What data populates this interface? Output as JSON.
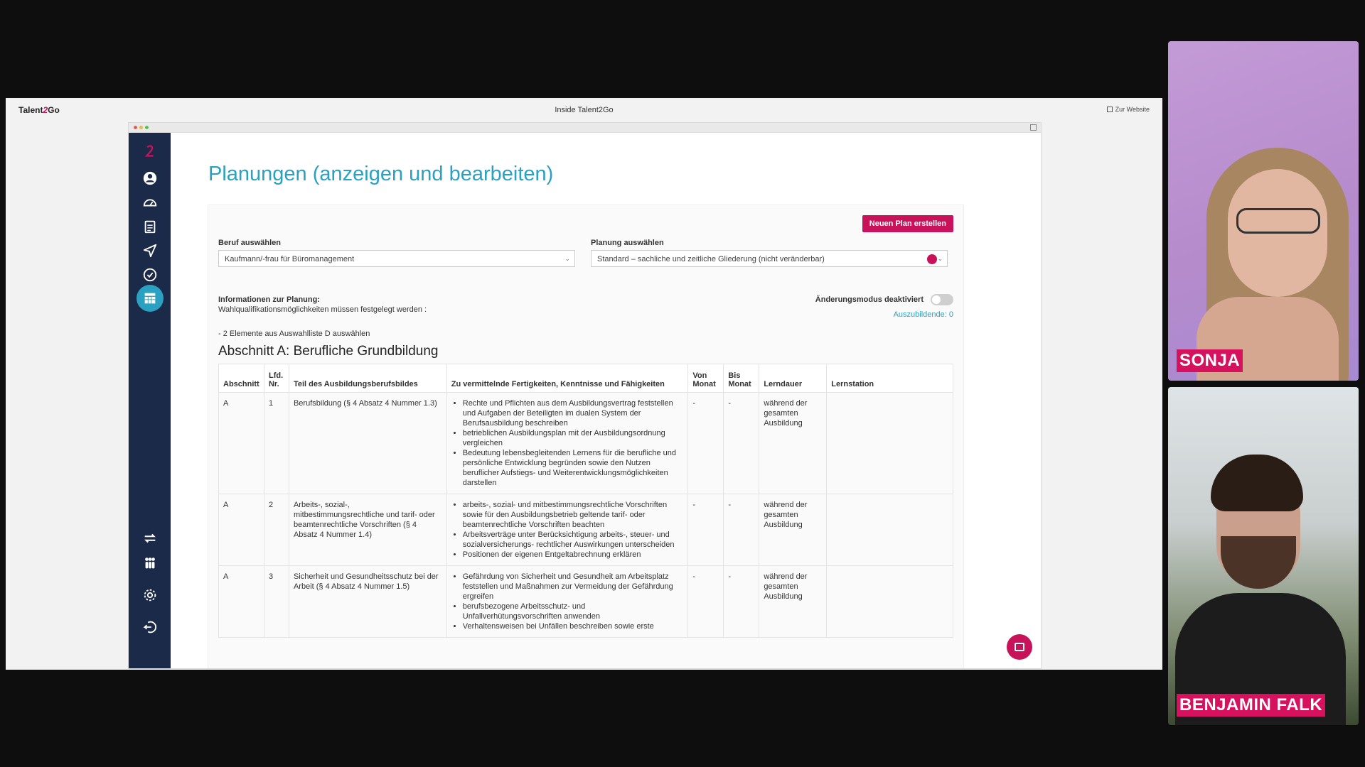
{
  "slide": {
    "brand_a": "Talent",
    "brand_b": "2",
    "brand_c": "Go",
    "title": "Inside Talent2Go",
    "website_link": "Zur Website"
  },
  "app": {
    "page_title": "Planungen (anzeigen und bearbeiten)",
    "new_plan_button": "Neuen Plan erstellen",
    "beruf_label": "Beruf auswählen",
    "beruf_value": "Kaufmann/-frau für Büromanagement",
    "planung_label": "Planung auswählen",
    "planung_value": "Standard – sachliche und zeitliche Gliederung (nicht veränderbar)",
    "info_title": "Informationen zur Planung:",
    "info_text": "Wahlqualifikationsmöglichkeiten müssen festgelegt werden :",
    "info_item": "- 2 Elemente aus Auswahlliste D auswählen",
    "toggle_label": "Änderungsmodus deaktiviert",
    "azubi_link": "Auszubildende: 0",
    "section_title": "Abschnitt A: Berufliche Grundbildung",
    "table": {
      "headers": [
        "Abschnitt",
        "Lfd. Nr.",
        "Teil des Ausbildungsberufsbildes",
        "Zu vermittelnde Fertigkeiten, Kenntnisse und Fähigkeiten",
        "Von Monat",
        "Bis Monat",
        "Lerndauer",
        "Lernstation"
      ],
      "rows": [
        {
          "abschnitt": "A",
          "nr": "1",
          "teil": "Berufsbildung (§ 4 Absatz 4 Nummer 1.3)",
          "skills": [
            "Rechte und Pflichten aus dem Ausbildungsvertrag feststellen und Aufgaben der Beteiligten im dualen System der Berufsausbildung beschreiben",
            "betrieblichen Ausbildungsplan mit der Ausbildungsordnung vergleichen",
            "Bedeutung lebensbegleitenden Lernens für die berufliche und persönliche Entwicklung begründen sowie den Nutzen beruflicher Aufstiegs- und Weiterentwicklungsmöglichkeiten darstellen"
          ],
          "von": "-",
          "bis": "-",
          "dauer": "während der gesamten Ausbildung"
        },
        {
          "abschnitt": "A",
          "nr": "2",
          "teil": "Arbeits-, sozial-, mitbestimmungsrechtliche und tarif- oder beamtenrechtliche Vorschriften (§ 4 Absatz 4 Nummer 1.4)",
          "skills": [
            "arbeits-, sozial- und mitbestimmungsrechtliche Vorschriften sowie für den Ausbildungsbetrieb geltende tarif- oder beamtenrechtliche Vorschriften beachten",
            "Arbeitsverträge unter Berücksichtigung arbeits-, steuer- und sozialversicherungs- rechtlicher Auswirkungen unterscheiden",
            "Positionen der eigenen Entgeltabrechnung erklären"
          ],
          "von": "-",
          "bis": "-",
          "dauer": "während der gesamten Ausbildung"
        },
        {
          "abschnitt": "A",
          "nr": "3",
          "teil": "Sicherheit und Gesundheitsschutz bei der Arbeit (§ 4 Absatz 4 Nummer 1.5)",
          "skills": [
            "Gefährdung von Sicherheit und Gesundheit am Arbeitsplatz feststellen und Maßnahmen zur Vermeidung der Gefährdung ergreifen",
            "berufsbezogene Arbeitsschutz- und Unfallverhütungsvorschriften anwenden",
            "Verhaltensweisen bei Unfällen beschreiben sowie erste"
          ],
          "von": "-",
          "bis": "-",
          "dauer": "während der gesamten Ausbildung"
        }
      ]
    }
  },
  "participants": [
    {
      "name": "SONJA"
    },
    {
      "name": "BENJAMIN FALK"
    }
  ],
  "colors": {
    "accent": "#2aa1c0",
    "brand": "#c8125a",
    "sidebar": "#1b2a48"
  }
}
